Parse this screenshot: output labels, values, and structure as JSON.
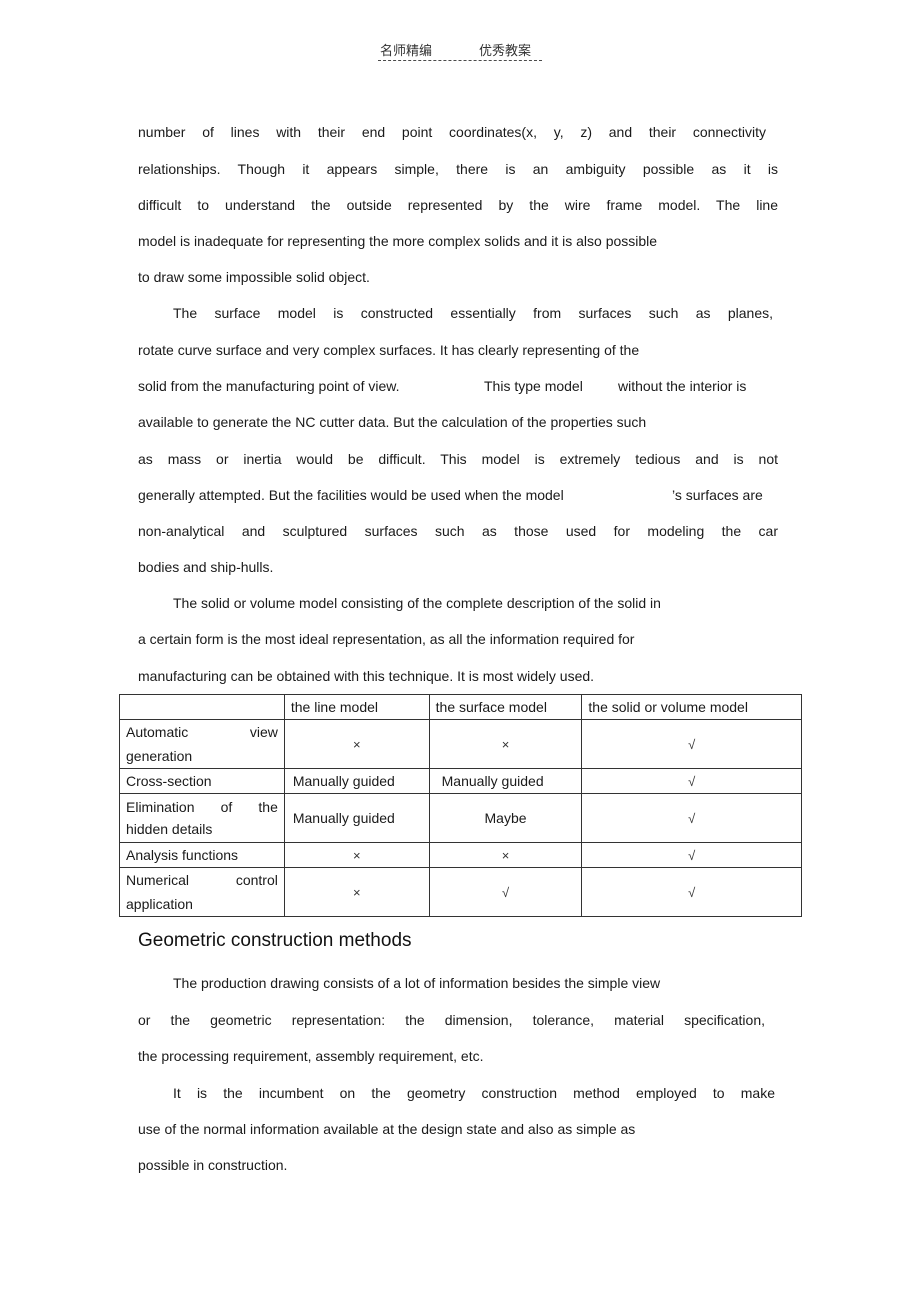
{
  "header": {
    "left_label": "名师精编",
    "right_label": "优秀教案"
  },
  "paragraphs": {
    "p1": [
      "number of lines with their end point coordinates(x, y, z) and their connectivity",
      "relationships. Though it appears simple, there is an ambiguity possible as it is",
      "difficult to understand the outside represented by the wire frame model. The line",
      "model is inadequate for representing the more complex solids and it is also possible",
      "to draw some impossible solid object."
    ],
    "p2": [
      "The surface model is constructed essentially from surfaces such as planes,",
      "rotate curve surface and very complex surfaces. It has clearly representing of the",
      "solid from the manufacturing point of view.",
      "This type model",
      "without the interior is",
      "available to generate the NC cutter data. But the calculation of the properties such",
      "as mass or inertia would be difficult. This model is extremely tedious and is not",
      "generally attempted. But the facilities would be used when the model",
      "’s surfaces are",
      "non-analytical and sculptured surfaces such as those used for modeling the car",
      "bodies and ship-hulls."
    ],
    "p3": [
      "The solid or volume model consisting of the complete description of the solid in",
      "a certain form is the most ideal representation, as all the information required for",
      "manufacturing can be obtained with this technique. It is most widely used."
    ]
  },
  "table": {
    "headers": [
      "",
      "the line model",
      "the surface model",
      "the solid or volume model"
    ],
    "rows": [
      {
        "label_a": "Automatic",
        "label_b": "view",
        "label_c": "generation",
        "cells": [
          "×",
          "×",
          "√"
        ]
      },
      {
        "label": "Cross-section",
        "cells": [
          "Manually guided",
          "Manually guided",
          "√"
        ]
      },
      {
        "label_a": "Elimination",
        "label_b": "of",
        "label_b2": "the",
        "label_c": "hidden details",
        "cells": [
          "Manually guided",
          "Maybe",
          "√"
        ]
      },
      {
        "label": "Analysis functions",
        "cells": [
          "×",
          "×",
          "√"
        ]
      },
      {
        "label_a": "Numerical",
        "label_b": "control",
        "label_c": "application",
        "cells": [
          "×",
          "√",
          "√"
        ]
      }
    ]
  },
  "section": {
    "heading": "Geometric construction methods",
    "p4": [
      "The production drawing consists of a lot of information besides the simple view",
      "or the geometric representation: the dimension, tolerance, material specification,",
      "the processing requirement, assembly requirement, etc."
    ],
    "p5": [
      "It is the incumbent on the geometry construction method employed to make",
      "use of the normal information available at the design state and also as simple as",
      "possible in construction."
    ]
  }
}
